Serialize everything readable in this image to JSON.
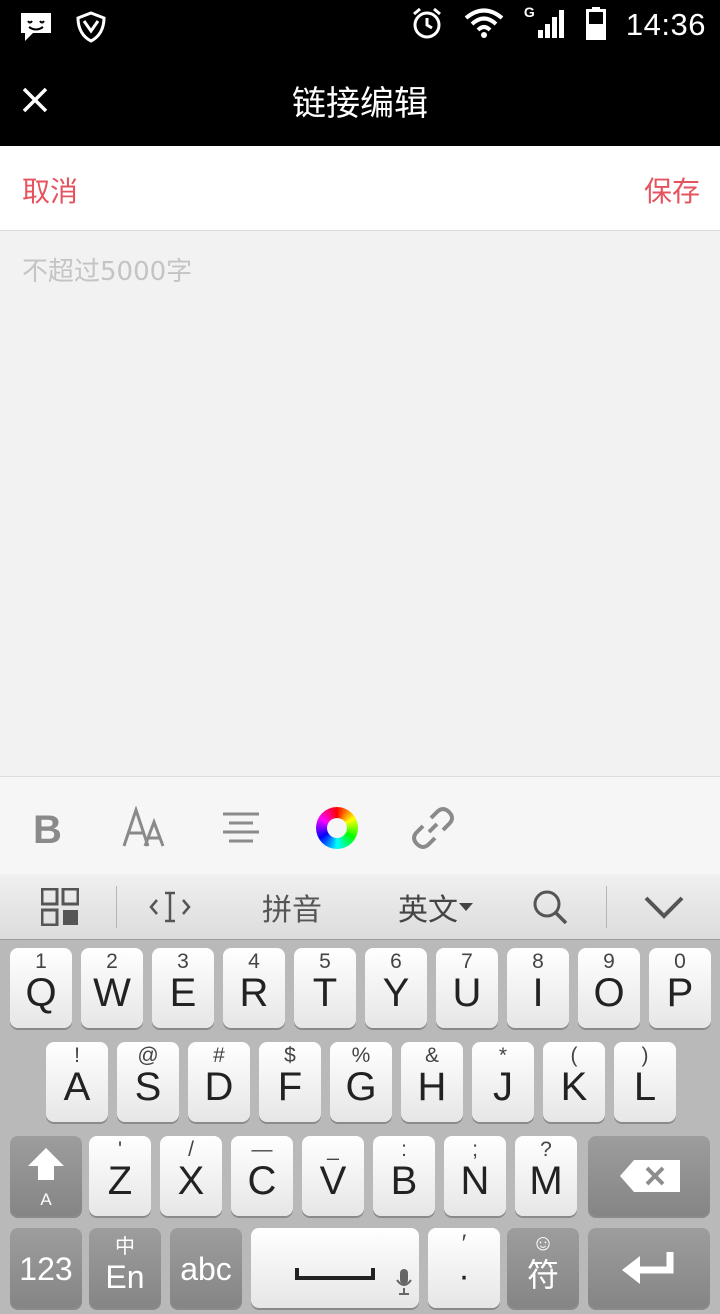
{
  "status_bar": {
    "time": "14:36",
    "network_label": "G",
    "icons": [
      "message-icon",
      "shield-icon",
      "alarm-icon",
      "wifi-icon",
      "signal-icon",
      "battery-icon"
    ]
  },
  "title_bar": {
    "title": "链接编辑",
    "close_icon": "close-icon"
  },
  "action_bar": {
    "cancel_label": "取消",
    "save_label": "保存",
    "accent_color": "#e5535f"
  },
  "editor": {
    "placeholder": "不超过5000字",
    "value": ""
  },
  "format_toolbar": {
    "buttons": [
      "bold-icon",
      "font-size-icon",
      "align-center-icon",
      "color-wheel-icon",
      "link-icon"
    ]
  },
  "keyboard": {
    "toolbar": {
      "grid_icon": "grid-icon",
      "cursor_icon": "cursor-icon",
      "pinyin_label": "拼音",
      "language_label": "英文",
      "search_icon": "search-icon",
      "collapse_icon": "chevron-down-icon"
    },
    "row1": [
      {
        "main": "Q",
        "sub": "1"
      },
      {
        "main": "W",
        "sub": "2"
      },
      {
        "main": "E",
        "sub": "3"
      },
      {
        "main": "R",
        "sub": "4"
      },
      {
        "main": "T",
        "sub": "5"
      },
      {
        "main": "Y",
        "sub": "6"
      },
      {
        "main": "U",
        "sub": "7"
      },
      {
        "main": "I",
        "sub": "8"
      },
      {
        "main": "O",
        "sub": "9"
      },
      {
        "main": "P",
        "sub": "0"
      }
    ],
    "row2": [
      {
        "main": "A",
        "sub": "!"
      },
      {
        "main": "S",
        "sub": "@"
      },
      {
        "main": "D",
        "sub": "#"
      },
      {
        "main": "F",
        "sub": "$"
      },
      {
        "main": "G",
        "sub": "%"
      },
      {
        "main": "H",
        "sub": "&"
      },
      {
        "main": "J",
        "sub": "*"
      },
      {
        "main": "K",
        "sub": "("
      },
      {
        "main": "L",
        "sub": ")"
      }
    ],
    "row3": [
      {
        "main": "Z",
        "sub": "'"
      },
      {
        "main": "X",
        "sub": "/"
      },
      {
        "main": "C",
        "sub": "—"
      },
      {
        "main": "V",
        "sub": "_"
      },
      {
        "main": "B",
        "sub": ":"
      },
      {
        "main": "N",
        "sub": ";"
      },
      {
        "main": "M",
        "sub": "?"
      }
    ],
    "shift_sub": "A",
    "num_label": "123",
    "lang_main": "En",
    "lang_sub": "中",
    "abc_label": "abc",
    "punct_main": "·",
    "punct_sub": "′",
    "symbol_main": "符",
    "symbol_sub": "☺"
  }
}
